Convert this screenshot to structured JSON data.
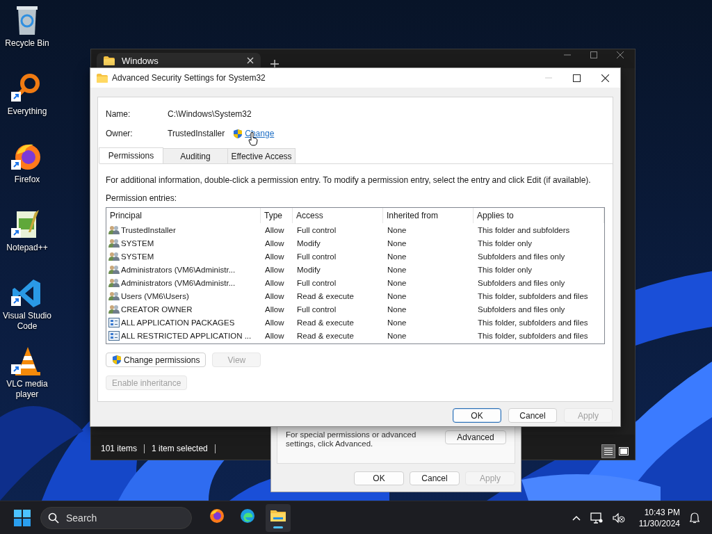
{
  "desktop_icons": [
    {
      "kind": "bin",
      "label": "Recycle Bin",
      "shortcut": false
    },
    {
      "kind": "search",
      "label": "Everything",
      "shortcut": true
    },
    {
      "kind": "firefox",
      "label": "Firefox",
      "shortcut": true
    },
    {
      "kind": "notepad",
      "label": "Notepad++",
      "shortcut": true
    },
    {
      "kind": "vscode",
      "label": "Visual Studio Code",
      "shortcut": true
    },
    {
      "kind": "vlc",
      "label": "VLC media player",
      "shortcut": true
    }
  ],
  "explorer": {
    "tab_title": "Windows",
    "status": [
      "101 items",
      "1 item selected"
    ],
    "view_modes": [
      {
        "kind": "details",
        "selected": true
      },
      {
        "kind": "tiles",
        "selected": false
      }
    ]
  },
  "properties_dialog": {
    "note": "For special permissions or advanced settings, click Advanced.",
    "advanced_button": "Advanced",
    "buttons": [
      {
        "label": "OK",
        "disabled": false
      },
      {
        "label": "Cancel",
        "disabled": false
      },
      {
        "label": "Apply",
        "disabled": true
      }
    ]
  },
  "security_dialog": {
    "title": "Advanced Security Settings for System32",
    "name_label": "Name:",
    "name_value": "C:\\Windows\\System32",
    "owner_label": "Owner:",
    "owner_value": "TrustedInstaller",
    "change_link": "Change",
    "tabs": [
      {
        "label": "Permissions",
        "selected": true
      },
      {
        "label": "Auditing",
        "selected": false
      },
      {
        "label": "Effective Access",
        "selected": false
      }
    ],
    "info": "For additional information, double-click a permission entry. To modify a permission entry, select the entry and click Edit (if available).",
    "entries_label": "Permission entries:",
    "columns": [
      "Principal",
      "Type",
      "Access",
      "Inherited from",
      "Applies to"
    ],
    "rows": [
      {
        "kind": "group",
        "cells": [
          "TrustedInstaller",
          "Allow",
          "Full control",
          "None",
          "This folder and subfolders"
        ]
      },
      {
        "kind": "group",
        "cells": [
          "SYSTEM",
          "Allow",
          "Modify",
          "None",
          "This folder only"
        ]
      },
      {
        "kind": "group",
        "cells": [
          "SYSTEM",
          "Allow",
          "Full control",
          "None",
          "Subfolders and files only"
        ]
      },
      {
        "kind": "group",
        "cells": [
          "Administrators (VM6\\Administr...",
          "Allow",
          "Modify",
          "None",
          "This folder only"
        ]
      },
      {
        "kind": "group",
        "cells": [
          "Administrators (VM6\\Administr...",
          "Allow",
          "Full control",
          "None",
          "Subfolders and files only"
        ]
      },
      {
        "kind": "group",
        "cells": [
          "Users (VM6\\Users)",
          "Allow",
          "Read & execute",
          "None",
          "This folder, subfolders and files"
        ]
      },
      {
        "kind": "group",
        "cells": [
          "CREATOR OWNER",
          "Allow",
          "Full control",
          "None",
          "Subfolders and files only"
        ]
      },
      {
        "kind": "package",
        "cells": [
          "ALL APPLICATION PACKAGES",
          "Allow",
          "Read & execute",
          "None",
          "This folder, subfolders and files"
        ]
      },
      {
        "kind": "package",
        "cells": [
          "ALL RESTRICTED APPLICATION ...",
          "Allow",
          "Read & execute",
          "None",
          "This folder, subfolders and files"
        ]
      }
    ],
    "action_buttons": [
      {
        "label": "Change permissions",
        "disabled": false,
        "shield": true
      },
      {
        "label": "View",
        "disabled": true,
        "shield": false
      }
    ],
    "inheritance_button": {
      "label": "Enable inheritance",
      "disabled": true
    },
    "footer_buttons": [
      {
        "label": "OK",
        "disabled": false,
        "default": true
      },
      {
        "label": "Cancel",
        "disabled": false,
        "default": false
      },
      {
        "label": "Apply",
        "disabled": true,
        "default": false
      }
    ]
  },
  "taskbar": {
    "search_placeholder": "Search",
    "apps": [
      {
        "kind": "firefox",
        "selected": false
      },
      {
        "kind": "edge",
        "selected": false
      },
      {
        "kind": "files",
        "selected": true
      }
    ],
    "time": "10:43 PM",
    "date": "11/30/2024"
  }
}
